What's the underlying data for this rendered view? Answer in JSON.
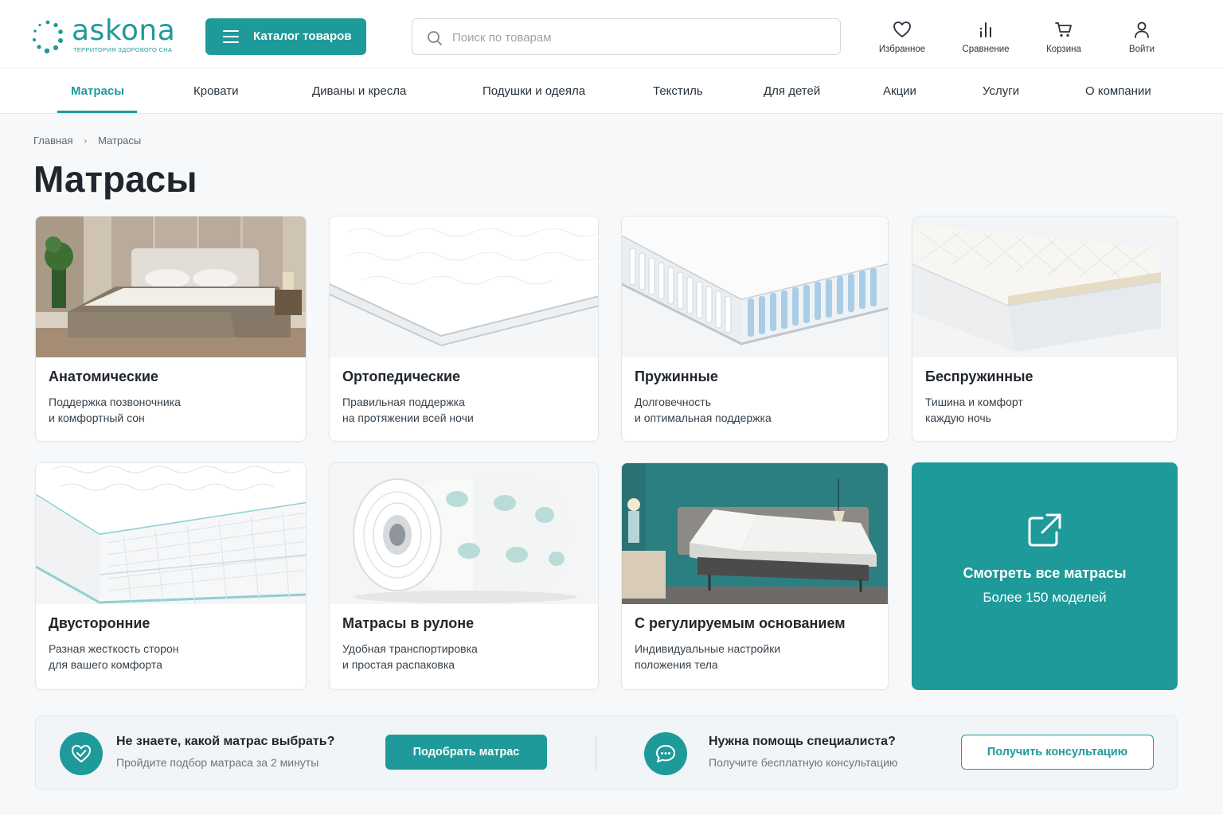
{
  "brand": {
    "name": "askona",
    "tagline": "ТЕРРИТОРИЯ ЗДОРОВОГО СНА",
    "accent": "#1f9a9a"
  },
  "header": {
    "catalog_label": "Каталог товаров",
    "search_placeholder": "Поиск по товарам",
    "actions": [
      {
        "label": "Избранное",
        "icon": "heart-icon"
      },
      {
        "label": "Сравнение",
        "icon": "compare-icon"
      },
      {
        "label": "Корзина",
        "icon": "cart-icon"
      },
      {
        "label": "Войти",
        "icon": "user-icon"
      }
    ]
  },
  "nav": {
    "items": [
      {
        "label": "Матрасы",
        "active": true
      },
      {
        "label": "Кровати"
      },
      {
        "label": "Диваны и кресла"
      },
      {
        "label": "Подушки и одеяла"
      },
      {
        "label": "Текстиль"
      },
      {
        "label": "Для детей"
      },
      {
        "label": "Акции"
      },
      {
        "label": "Услуги"
      },
      {
        "label": "О компании"
      }
    ]
  },
  "breadcrumb": {
    "home": "Главная",
    "separator": "›",
    "current": "Матрасы"
  },
  "page": {
    "title": "Матрасы"
  },
  "categories": [
    {
      "title": "Анатомические",
      "line1": "Поддержка позвоночника",
      "line2": "и комфортный сон",
      "image": "bedroom-bed"
    },
    {
      "title": "Ортопедические",
      "line1": "Правильная поддержка",
      "line2": "на протяжении всей ночи",
      "image": "white-mattress"
    },
    {
      "title": "Пружинные",
      "line1": "Долговечность",
      "line2": "и оптимальная поддержка",
      "image": "spring-mattress"
    },
    {
      "title": "Беспружинные",
      "line1": "Тишина и комфорт",
      "line2": "каждую ночь",
      "image": "foam-mattress"
    },
    {
      "title": "Двусторонние",
      "line1": "Разная жесткость сторон",
      "line2": "для вашего комфорта",
      "image": "quilted-mattress"
    },
    {
      "title": "Матрасы в рулоне",
      "line1": "Удобная транспортировка",
      "line2": "и простая распаковка",
      "image": "rolled-mattress"
    },
    {
      "title": "С регулируемым основанием",
      "line1": "Индивидуальные настройки",
      "line2": "положения тела",
      "image": "adjustable-bed"
    }
  ],
  "view_all": {
    "title": "Смотреть все матрасы",
    "subtitle": "Более 150 моделей",
    "icon": "external-link-icon"
  },
  "banner": {
    "left": {
      "title": "Не знаете, какой матрас выбрать?",
      "subtitle": "Пройдите подбор матраса за 2 минуты",
      "button": "Подобрать матрас",
      "icon": "heart-check-icon"
    },
    "right": {
      "title": "Нужна помощь специалиста?",
      "subtitle": "Получите бесплатную консультацию",
      "button": "Получить консультацию",
      "icon": "chat-icon"
    }
  }
}
